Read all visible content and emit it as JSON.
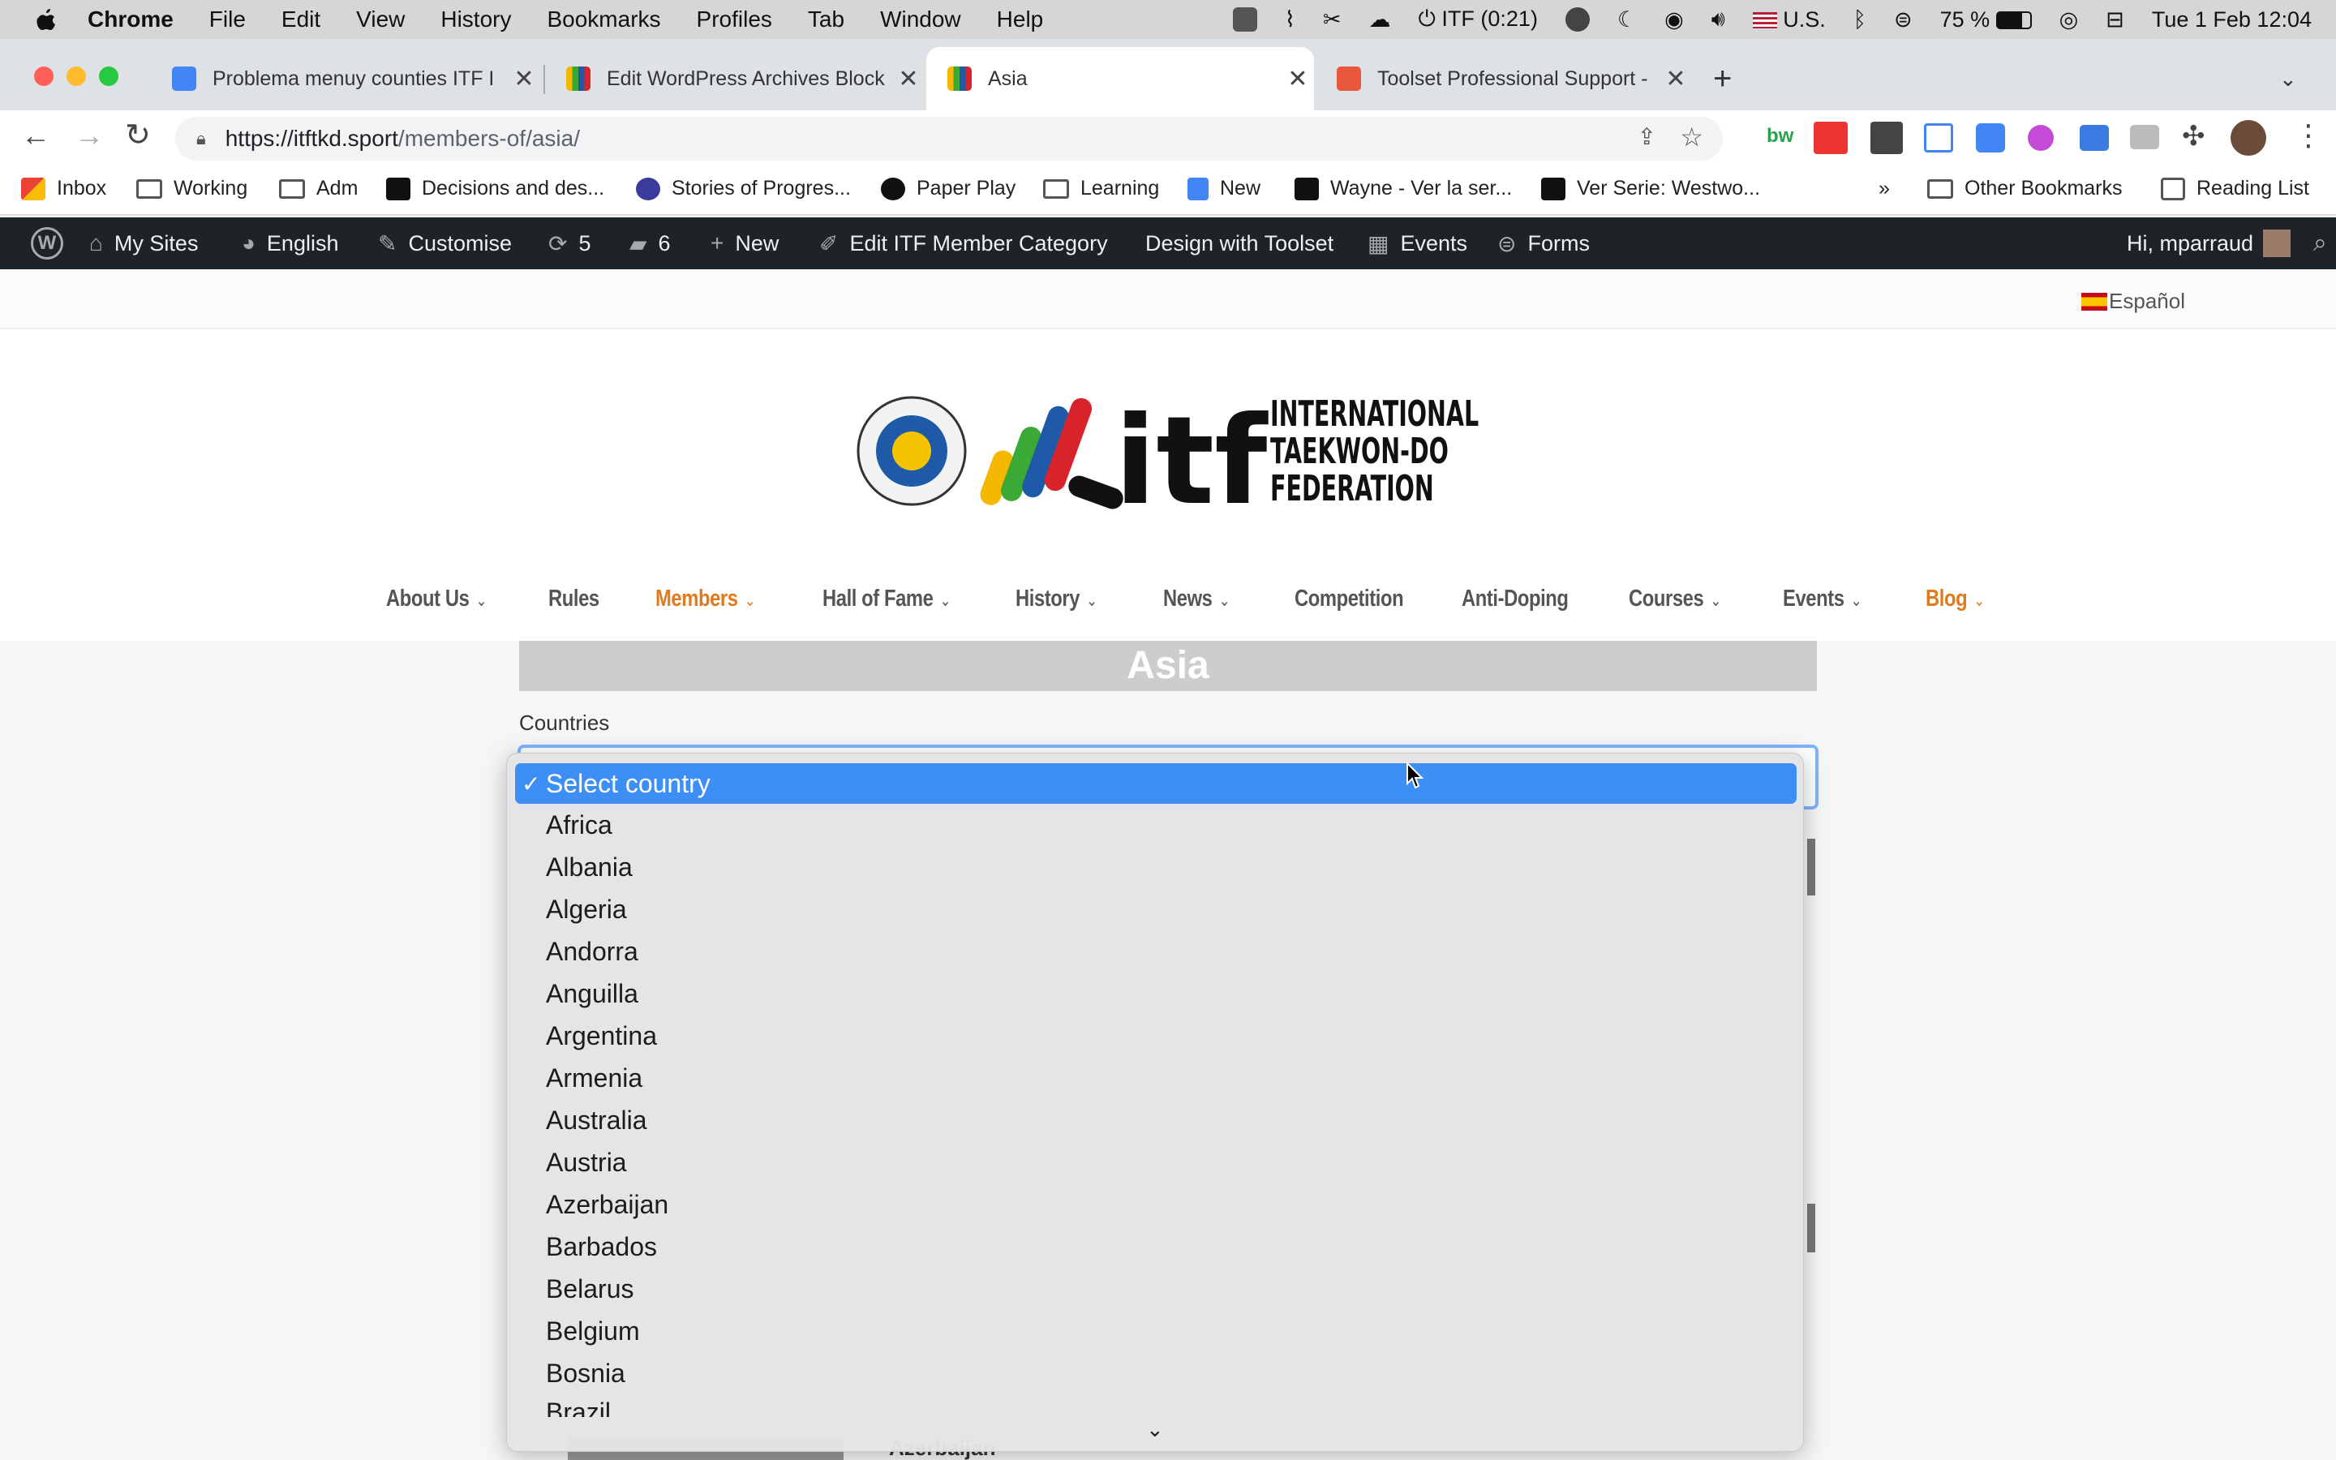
{
  "menubar": {
    "app": "Chrome",
    "items": [
      "File",
      "Edit",
      "View",
      "History",
      "Bookmarks",
      "Profiles",
      "Tab",
      "Window",
      "Help"
    ],
    "timer": "ITF (0:21)",
    "input_source": "U.S.",
    "battery": "75 %",
    "datetime": "Tue 1 Feb  12:04"
  },
  "tabs": [
    {
      "title": "Problema menuy counties ITF I",
      "color": "#4285f4"
    },
    {
      "title": "Edit WordPress Archives Block",
      "color": "#cc3333"
    },
    {
      "title": "Asia",
      "color": "#cc3333"
    },
    {
      "title": "Toolset Professional Support -",
      "color": "#e8573c"
    }
  ],
  "newtab": "+",
  "address": {
    "host": "https://itftkd.sport",
    "path": "/members-of/asia/"
  },
  "bookmarks": {
    "items": [
      {
        "label": "Inbox",
        "kind": "gmail"
      },
      {
        "label": "Working",
        "kind": "folder"
      },
      {
        "label": "Adm",
        "kind": "folder"
      },
      {
        "label": "Decisions and des...",
        "kind": "site"
      },
      {
        "label": "Stories of Progres...",
        "kind": "site"
      },
      {
        "label": "Paper Play",
        "kind": "site"
      },
      {
        "label": "Learning",
        "kind": "folder"
      },
      {
        "label": "New",
        "kind": "doc"
      },
      {
        "label": "Wayne - Ver la ser...",
        "kind": "site"
      },
      {
        "label": "Ver Serie: Westwo...",
        "kind": "site"
      }
    ],
    "overflow": "»",
    "other": "Other Bookmarks",
    "reading": "Reading List"
  },
  "adminbar": {
    "my_sites": "My Sites",
    "language": "English",
    "customise": "Customise",
    "updates": "5",
    "comments": "6",
    "new": "New",
    "edit": "Edit ITF Member Category",
    "design": "Design with Toolset",
    "events": "Events",
    "forms": "Forms",
    "greeting": "Hi, mparraud"
  },
  "site": {
    "language_switch": "Español",
    "logo_text": [
      "INTERNATIONAL",
      "TAEKWON-DO",
      "FEDERATION"
    ],
    "logo_mark": "itf",
    "nav": [
      {
        "label": "About Us",
        "chev": true,
        "accent": false
      },
      {
        "label": "Rules",
        "chev": false,
        "accent": false
      },
      {
        "label": "Members",
        "chev": true,
        "accent": true
      },
      {
        "label": "Hall of Fame",
        "chev": true,
        "accent": false
      },
      {
        "label": "History",
        "chev": true,
        "accent": false
      },
      {
        "label": "News",
        "chev": true,
        "accent": false
      },
      {
        "label": "Competition",
        "chev": false,
        "accent": false
      },
      {
        "label": "Anti-Doping",
        "chev": false,
        "accent": false
      },
      {
        "label": "Courses",
        "chev": true,
        "accent": false
      },
      {
        "label": "Events",
        "chev": true,
        "accent": false
      },
      {
        "label": "Blog",
        "chev": true,
        "accent": true
      }
    ],
    "page_title": "Asia",
    "countries_label": "Countries",
    "behind_text": "Azerbaijan"
  },
  "dropdown": {
    "selected": "Select country",
    "options": [
      "Africa",
      "Albania",
      "Algeria",
      "Andorra",
      "Anguilla",
      "Argentina",
      "Armenia",
      "Australia",
      "Austria",
      "Azerbaijan",
      "Barbados",
      "Belarus",
      "Belgium",
      "Bosnia",
      "Brazil"
    ]
  },
  "colors": {
    "accent_orange": "#e07a1f",
    "admin_bg": "#1d2327",
    "select_blue": "#3d8ff5"
  }
}
